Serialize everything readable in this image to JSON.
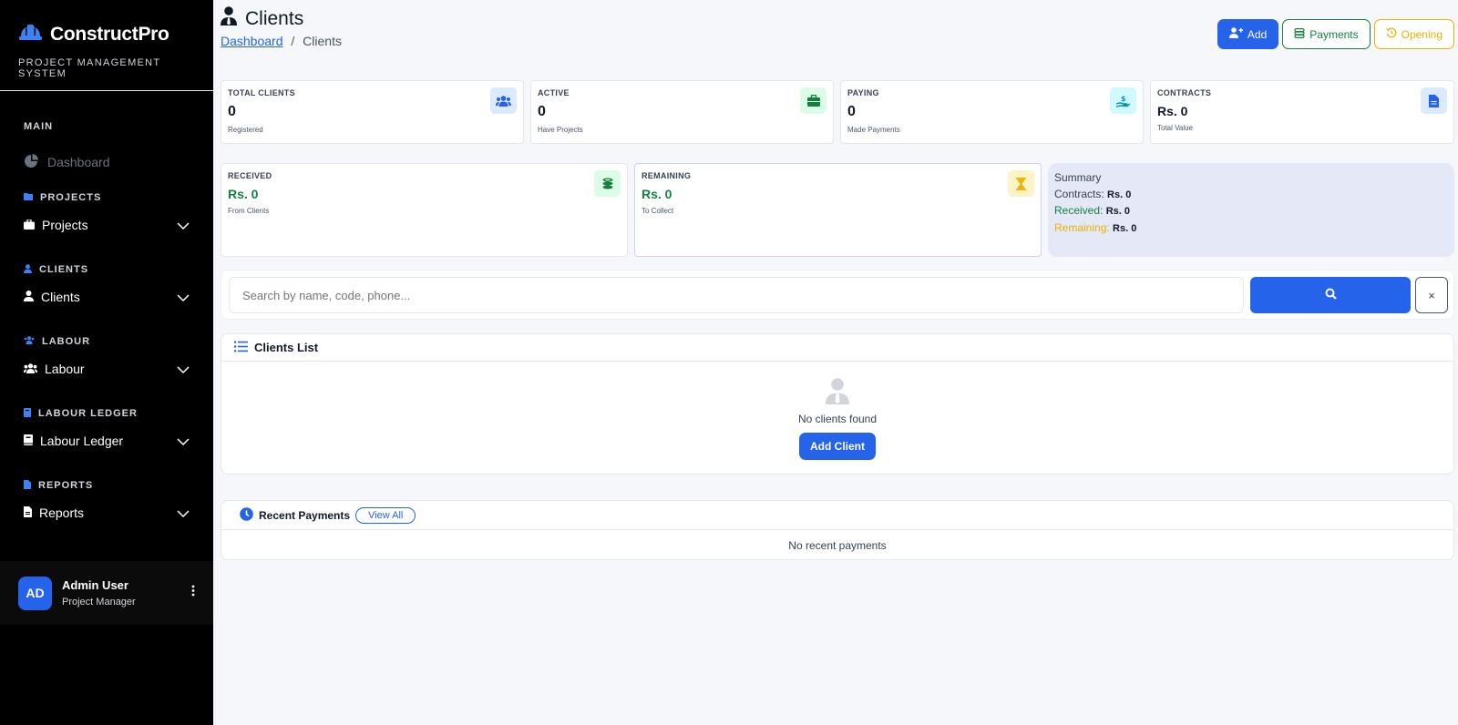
{
  "brand": {
    "title": "ConstructPro",
    "subtitle": "PROJECT MANAGEMENT SYSTEM"
  },
  "nav": {
    "main_label": "MAIN",
    "dashboard": "Dashboard",
    "projects_section": "PROJECTS",
    "projects": "Projects",
    "clients_section": "CLIENTS",
    "clients": "Clients",
    "labour_section": "LABOUR",
    "labour": "Labour",
    "ledger_section": "LABOUR LEDGER",
    "ledger": "Labour Ledger",
    "reports_section": "REPORTS",
    "reports": "Reports"
  },
  "user": {
    "initials": "AD",
    "name": "Admin User",
    "role": "Project Manager"
  },
  "page": {
    "title": "Clients",
    "breadcrumb_home": "Dashboard",
    "breadcrumb_sep": "/",
    "breadcrumb_current": "Clients"
  },
  "actions": {
    "add": "Add",
    "payments": "Payments",
    "opening": "Opening"
  },
  "stats": {
    "total": {
      "label": "TOTAL CLIENTS",
      "value": "0",
      "sub": "Registered"
    },
    "active": {
      "label": "ACTIVE",
      "value": "0",
      "sub": "Have Projects"
    },
    "paying": {
      "label": "PAYING",
      "value": "0",
      "sub": "Made Payments"
    },
    "contracts": {
      "label": "CONTRACTS",
      "value": "Rs. 0",
      "sub": "Total Value"
    },
    "received": {
      "label": "RECEIVED",
      "value": "Rs. 0",
      "sub": "From Clients"
    },
    "remaining": {
      "label": "REMAINING",
      "value": "Rs. 0",
      "sub": "To Collect"
    }
  },
  "summary": {
    "title": "Summary",
    "contracts_label": "Contracts:",
    "contracts_value": "Rs. 0",
    "received_label": "Received:",
    "received_value": "Rs. 0",
    "remaining_label": "Remaining:",
    "remaining_value": "Rs. 0"
  },
  "search": {
    "placeholder": "Search by name, code, phone...",
    "clear": "×"
  },
  "clients_list": {
    "title": "Clients List",
    "empty": "No clients found",
    "add_button": "Add Client"
  },
  "payments": {
    "title": "Recent Payments",
    "view_all": "View All",
    "empty": "No recent payments"
  },
  "colors": {
    "primary": "#2563eb",
    "green": "#15803d",
    "yellow": "#eab308",
    "sidebar": "#000000"
  }
}
